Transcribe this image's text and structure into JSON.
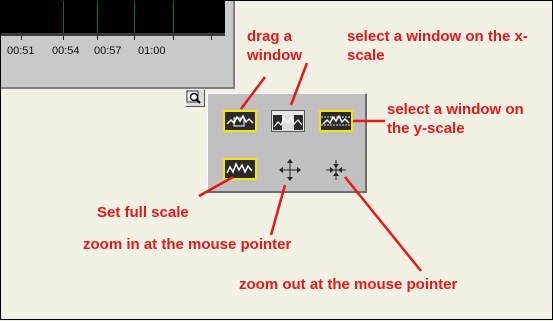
{
  "graph": {
    "time_labels": [
      "00:51",
      "00:54",
      "00:57",
      "01:00"
    ]
  },
  "annotations": {
    "drag_window": "drag a window",
    "select_x": "select a window on the x-scale",
    "select_y": "select a window on the y-scale",
    "full_scale": "Set full scale",
    "zoom_in": "zoom in at the mouse pointer",
    "zoom_out": "zoom out at the mouse pointer"
  },
  "palette": {
    "tools": [
      "drag-window",
      "select-x-window",
      "select-y-window",
      "set-full-scale",
      "zoom-in",
      "zoom-out"
    ]
  },
  "colors": {
    "annotation": "#e21a1a",
    "plot_background": "#000000",
    "grid": "#1d6b1d",
    "icon_highlight": "#f2e600"
  }
}
